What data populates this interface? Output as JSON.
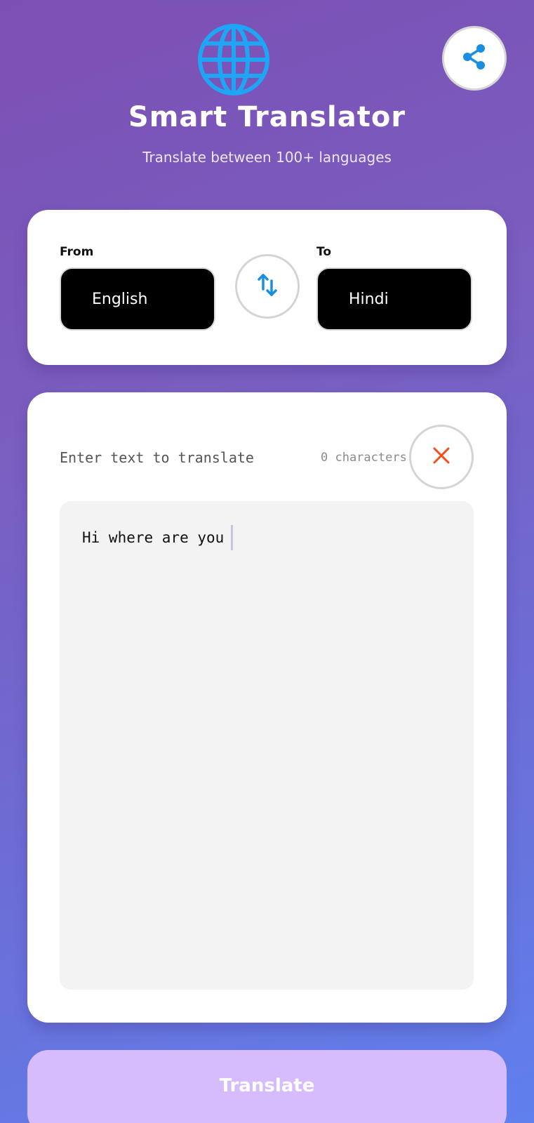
{
  "header": {
    "title": "Smart Translator",
    "subtitle": "Translate between 100+ languages",
    "logo_icon": "globe-icon",
    "share_icon": "share-icon"
  },
  "languages": {
    "from_label": "From",
    "from_value": "English",
    "to_label": "To",
    "to_value": "Hindi",
    "swap_icon": "swap-vertical-icon"
  },
  "input": {
    "label": "Enter text to translate",
    "char_count": "0 characters",
    "clear_icon": "close-icon",
    "text": "Hi where are you"
  },
  "actions": {
    "translate_label": "Translate"
  },
  "colors": {
    "accent_blue": "#1a8ee0",
    "globe_blue": "#1ea6f5",
    "clear_red": "#f0501e",
    "translate_button": "#d6bcfd"
  }
}
